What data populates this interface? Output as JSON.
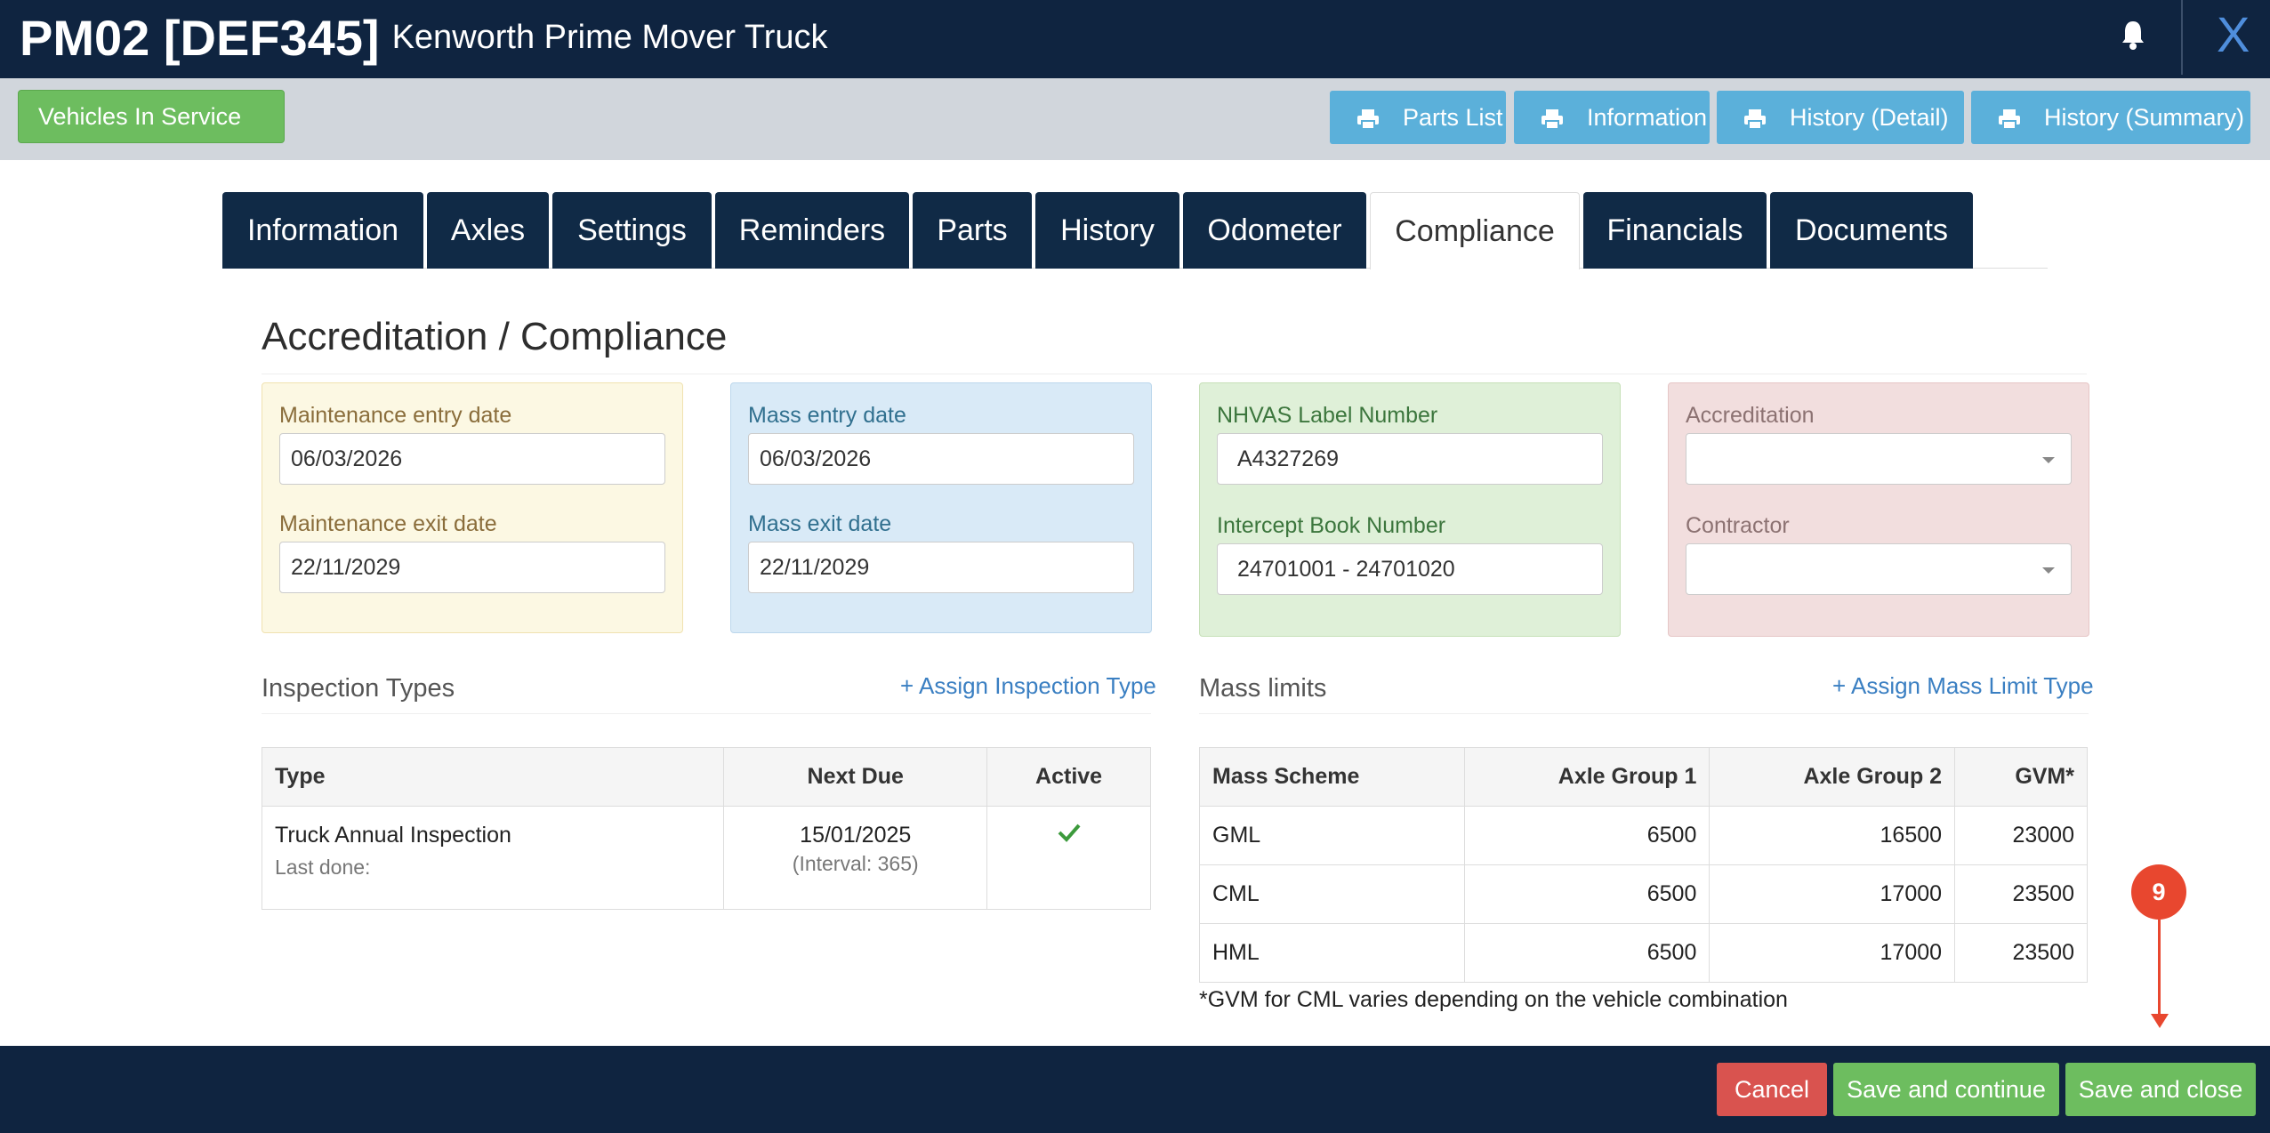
{
  "header": {
    "code": "PM02 [DEF345]",
    "subtitle": "Kenworth Prime Mover Truck",
    "close_label": "X"
  },
  "toolbar": {
    "status_button": "Vehicles In Service",
    "print_buttons": [
      "Parts List",
      "Information",
      "History (Detail)",
      "History (Summary)"
    ]
  },
  "tabs": [
    "Information",
    "Axles",
    "Settings",
    "Reminders",
    "Parts",
    "History",
    "Odometer",
    "Compliance",
    "Financials",
    "Documents"
  ],
  "active_tab": "Compliance",
  "section_title": "Accreditation / Compliance",
  "maintenance": {
    "entry_label": "Maintenance entry date",
    "entry_value": "06/03/2026",
    "exit_label": "Maintenance exit date",
    "exit_value": "22/11/2029"
  },
  "mass": {
    "entry_label": "Mass entry date",
    "entry_value": "06/03/2026",
    "exit_label": "Mass exit date",
    "exit_value": "22/11/2029"
  },
  "nhvas": {
    "label_number_label": "NHVAS Label Number",
    "label_number_value": "A4327269",
    "intercept_label": "Intercept Book Number",
    "intercept_value": "24701001 - 24701020"
  },
  "accreditation": {
    "accreditation_label": "Accreditation",
    "accreditation_value": "",
    "contractor_label": "Contractor",
    "contractor_value": ""
  },
  "inspection_types": {
    "title": "Inspection Types",
    "assign_link": "+ Assign Inspection Type",
    "columns": [
      "Type",
      "Next Due",
      "Active"
    ],
    "rows": [
      {
        "type": "Truck Annual Inspection",
        "last_done": "Last done:",
        "next_due": "15/01/2025",
        "interval": "(Interval: 365)",
        "active": true
      }
    ]
  },
  "mass_limits": {
    "title": "Mass limits",
    "assign_link": "+ Assign Mass Limit Type",
    "columns": [
      "Mass Scheme",
      "Axle Group 1",
      "Axle Group 2",
      "GVM*"
    ],
    "rows": [
      [
        "GML",
        "6500",
        "16500",
        "23000"
      ],
      [
        "CML",
        "6500",
        "17000",
        "23500"
      ],
      [
        "HML",
        "6500",
        "17000",
        "23500"
      ]
    ],
    "footnote": "*GVM for CML varies depending on the vehicle combination"
  },
  "annotation_marker": "9",
  "footer": {
    "cancel": "Cancel",
    "save_continue": "Save and continue",
    "save_close": "Save and close"
  },
  "colors": {
    "navy": "#0f2440",
    "green": "#6dbd5f",
    "print_blue": "#5bb0da",
    "danger": "#d9534f",
    "marker": "#e8472f"
  }
}
